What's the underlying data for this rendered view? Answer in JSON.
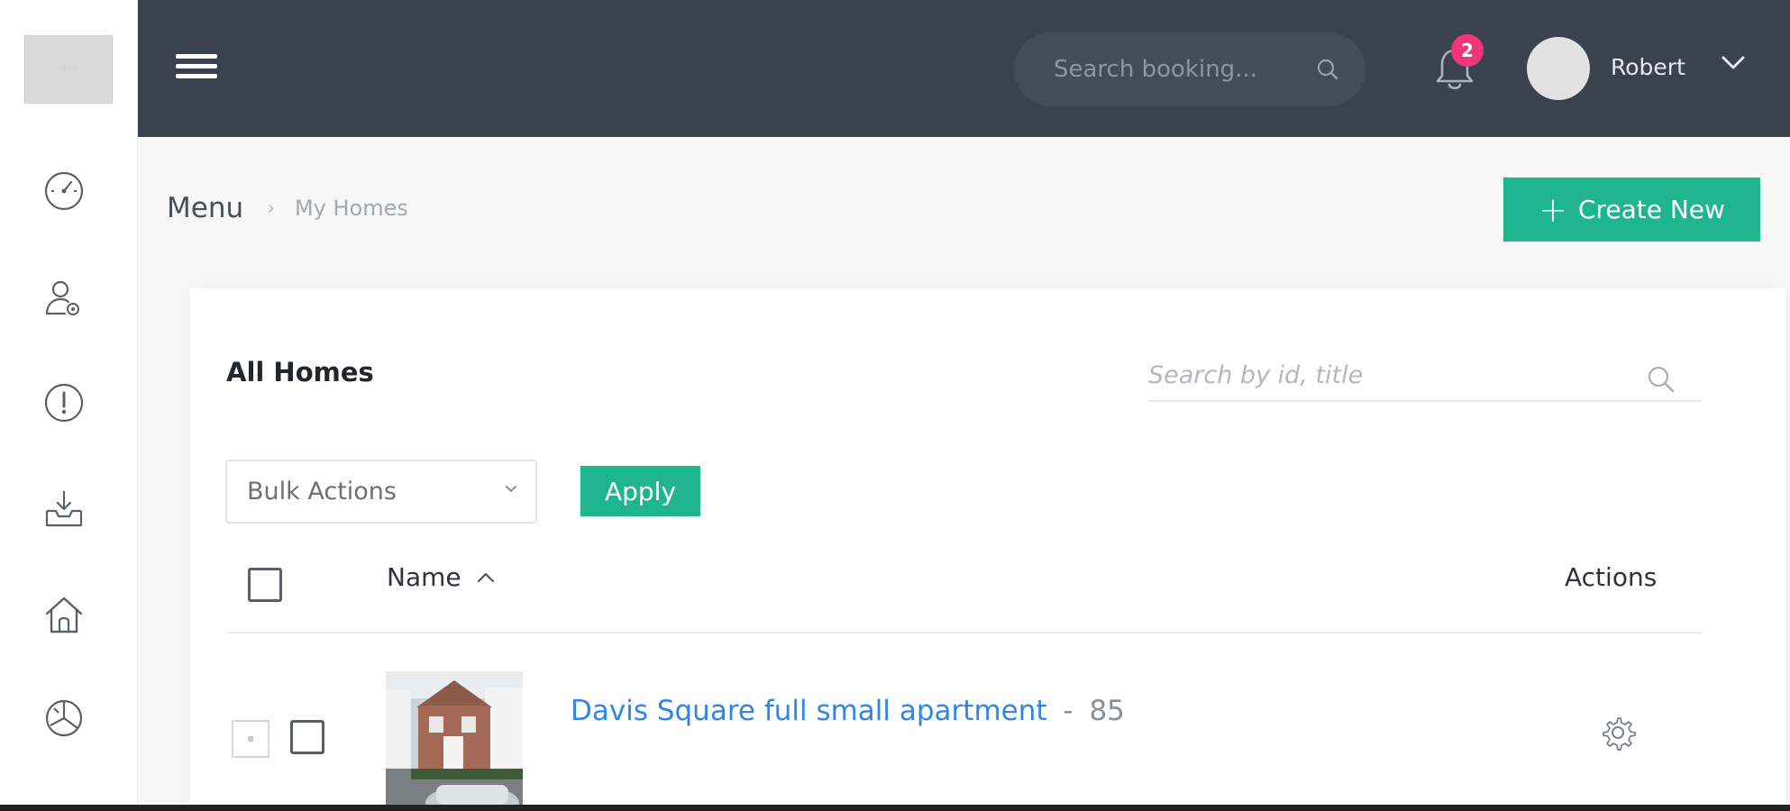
{
  "sidebar": {
    "logo_text": "LOGO",
    "items": [
      {
        "name": "dashboard",
        "icon": "gauge-icon"
      },
      {
        "name": "users",
        "icon": "user-settings-icon"
      },
      {
        "name": "info",
        "icon": "info-icon"
      },
      {
        "name": "bookings",
        "icon": "inbox-download-icon"
      },
      {
        "name": "homes",
        "icon": "home-icon"
      },
      {
        "name": "reports",
        "icon": "pie-chart-icon"
      }
    ]
  },
  "header": {
    "search": {
      "placeholder": "Search booking..."
    },
    "notifications": {
      "count": "2"
    },
    "user": {
      "name": "Robert"
    }
  },
  "breadcrumb": {
    "root": "Menu",
    "separator": "›",
    "current": "My Homes"
  },
  "toolbar": {
    "create_label": "Create New",
    "create_icon": "+"
  },
  "card": {
    "title": "All Homes",
    "search": {
      "placeholder": "Search by id, title"
    },
    "bulk": {
      "selected": "Bulk Actions",
      "apply_label": "Apply"
    },
    "table": {
      "columns": [
        "Name",
        "Actions"
      ],
      "rows": [
        {
          "title": "Davis Square full small apartment",
          "separator": "-",
          "id": "85"
        }
      ]
    }
  },
  "colors": {
    "topbar": "#3a424d",
    "accent": "#1fb58f",
    "link": "#2f86e6",
    "badge": "#f0357a"
  }
}
